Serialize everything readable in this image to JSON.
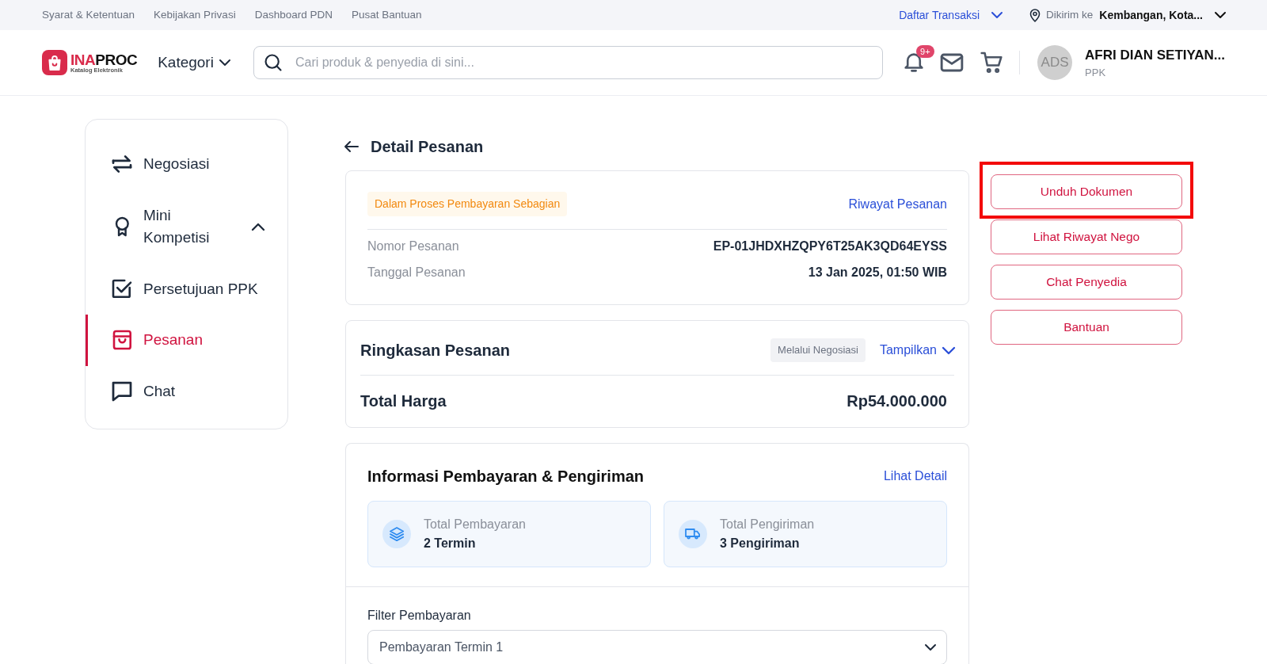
{
  "top_links": [
    "Syarat & Ketentuan",
    "Kebijakan Privasi",
    "Dashboard PDN",
    "Pusat Bantuan"
  ],
  "top_right": {
    "transactions": "Daftar Transaksi",
    "ship_label": "Dikirim ke",
    "ship_location": "Kembangan, Kota..."
  },
  "header": {
    "logo": {
      "name_parts": [
        "INA",
        "PROC"
      ],
      "tagline": "Katalog Elektronik"
    },
    "category": "Kategori",
    "search": {
      "placeholder": "Cari produk & penyedia di sini..."
    },
    "notification_count": "9+",
    "user": {
      "initials": "ADS",
      "name": "AFRI DIAN SETIYAN...",
      "role": "PPK"
    }
  },
  "sidebar": {
    "items": [
      {
        "kind": "swap",
        "label": "Negosiasi",
        "selected": false
      },
      {
        "kind": "award",
        "label": "Mini Kompetisi",
        "selected": false,
        "expanded": true
      },
      {
        "kind": "check",
        "label": "Persetujuan PPK",
        "selected": false
      },
      {
        "kind": "bag",
        "label": "Pesanan",
        "selected": true
      },
      {
        "kind": "chat",
        "label": "Chat",
        "selected": false
      }
    ]
  },
  "page_title": "Detail Pesanan",
  "order": {
    "status": "Dalam Proses Pembayaran Sebagian",
    "history_link": "Riwayat Pesanan",
    "fields": [
      {
        "label": "Nomor Pesanan",
        "value": "EP-01JHDXHZQPY6T25AK3QD64EYSS"
      },
      {
        "label": "Tanggal Pesanan",
        "value": "13 Jan 2025, 01:50 WIB"
      }
    ]
  },
  "summary": {
    "title": "Ringkasan Pesanan",
    "tag": "Melalui Negosiasi",
    "toggle": "Tampilkan",
    "expanded": false,
    "total_label": "Total Harga",
    "total_value": "Rp54.000.000"
  },
  "payment": {
    "title": "Informasi Pembayaran & Pengiriman",
    "link": "Lihat Detail",
    "stats": [
      {
        "kind": "layers",
        "label": "Total Pembayaran",
        "value": "2 Termin"
      },
      {
        "kind": "truck",
        "label": "Total Pengiriman",
        "value": "3 Pengiriman"
      }
    ],
    "filter_label": "Filter Pembayaran",
    "filter_value": "Pembayaran Termin 1"
  },
  "actions": [
    {
      "label": "Unduh Dokumen",
      "highlighted": true
    },
    {
      "label": "Lihat Riwayat Nego",
      "highlighted": false
    },
    {
      "label": "Chat Penyedia",
      "highlighted": false
    },
    {
      "label": "Bantuan",
      "highlighted": false
    }
  ]
}
